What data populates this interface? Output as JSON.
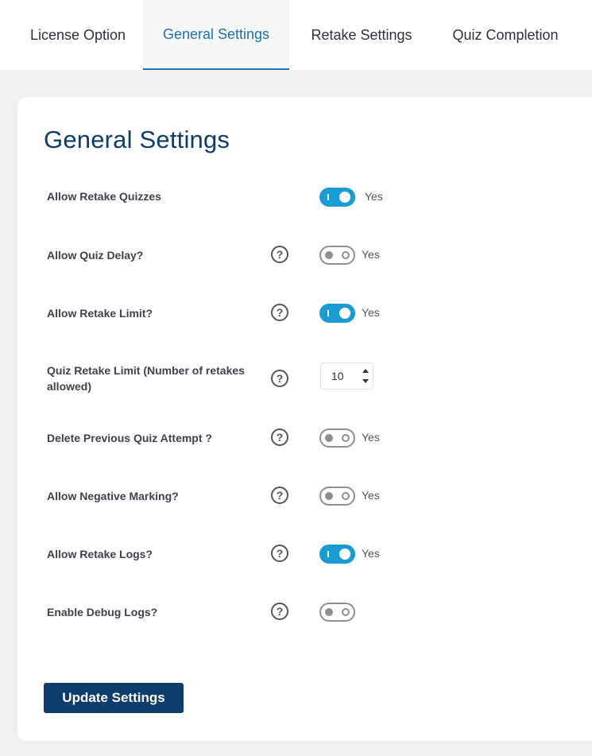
{
  "tabs": [
    {
      "label": "License Option",
      "active": false
    },
    {
      "label": "General Settings",
      "active": true
    },
    {
      "label": "Retake Settings",
      "active": false
    },
    {
      "label": "Quiz Completion",
      "active": false
    }
  ],
  "page_title": "General Settings",
  "settings": [
    {
      "label": "Allow Retake Quizzes",
      "has_help": false,
      "control": "toggle",
      "on": true,
      "value_label": "Yes"
    },
    {
      "label": "Allow Quiz Delay?",
      "has_help": true,
      "control": "toggle",
      "on": false,
      "value_label": "Yes"
    },
    {
      "label": "Allow Retake Limit?",
      "has_help": true,
      "control": "toggle",
      "on": true,
      "value_label": "Yes"
    },
    {
      "label": "Quiz Retake Limit (Number of retakes allowed)",
      "has_help": true,
      "control": "number",
      "value": "10"
    },
    {
      "label": "Delete Previous Quiz Attempt ?",
      "has_help": true,
      "control": "toggle",
      "on": false,
      "value_label": "Yes"
    },
    {
      "label": "Allow Negative Marking?",
      "has_help": true,
      "control": "toggle",
      "on": false,
      "value_label": "Yes"
    },
    {
      "label": "Allow Retake Logs?",
      "has_help": true,
      "control": "toggle",
      "on": true,
      "value_label": "Yes"
    },
    {
      "label": "Enable Debug Logs?",
      "has_help": true,
      "control": "toggle",
      "on": false,
      "value_label": ""
    }
  ],
  "help_glyph": "?",
  "update_button": "Update Settings",
  "colors": {
    "accent": "#2271b1",
    "toggle_on": "#1a9bd4",
    "title": "#0e3c6b",
    "button": "#0e3c6b"
  }
}
